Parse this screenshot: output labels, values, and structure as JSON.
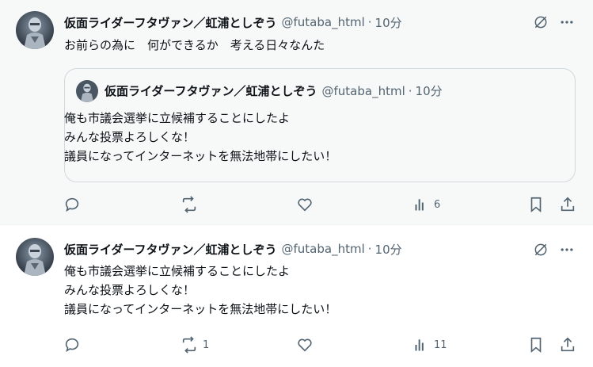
{
  "colors": {
    "text": "#0f1419",
    "secondary": "#536471",
    "border": "#cfd9de",
    "highlight_bg": "#f7f9f9"
  },
  "tweets": [
    {
      "author_name": "仮面ライダーフタヴァン／虹浦としぞう",
      "handle": "@futaba_html",
      "separator": "·",
      "time": "10分",
      "text": "お前らの為に　何ができるか　考える日々なんた",
      "quote": {
        "author_name": "仮面ライダーフタヴァン／虹浦としぞう",
        "handle": "@futaba_html",
        "separator": "·",
        "time": "10分",
        "text": "俺も市議会選挙に立候補することにしたよ\nみんな投票よろしくな！\n議員になってインターネットを無法地帯にしたい！"
      },
      "actions": {
        "reply_icon": "speech-bubble-icon",
        "repost_icon": "repost-icon",
        "like_icon": "heart-icon",
        "views_icon": "bar-chart-icon",
        "views": "6",
        "bookmark_icon": "bookmark-icon",
        "share_icon": "share-icon"
      }
    },
    {
      "author_name": "仮面ライダーフタヴァン／虹浦としぞう",
      "handle": "@futaba_html",
      "separator": "·",
      "time": "10分",
      "text": "俺も市議会選挙に立候補することにしたよ\nみんな投票よろしくな！\n議員になってインターネットを無法地帯にしたい！",
      "actions": {
        "reply_icon": "speech-bubble-icon",
        "repost_icon": "repost-icon",
        "reposts": "1",
        "like_icon": "heart-icon",
        "views_icon": "bar-chart-icon",
        "views": "11",
        "bookmark_icon": "bookmark-icon",
        "share_icon": "share-icon"
      }
    }
  ]
}
